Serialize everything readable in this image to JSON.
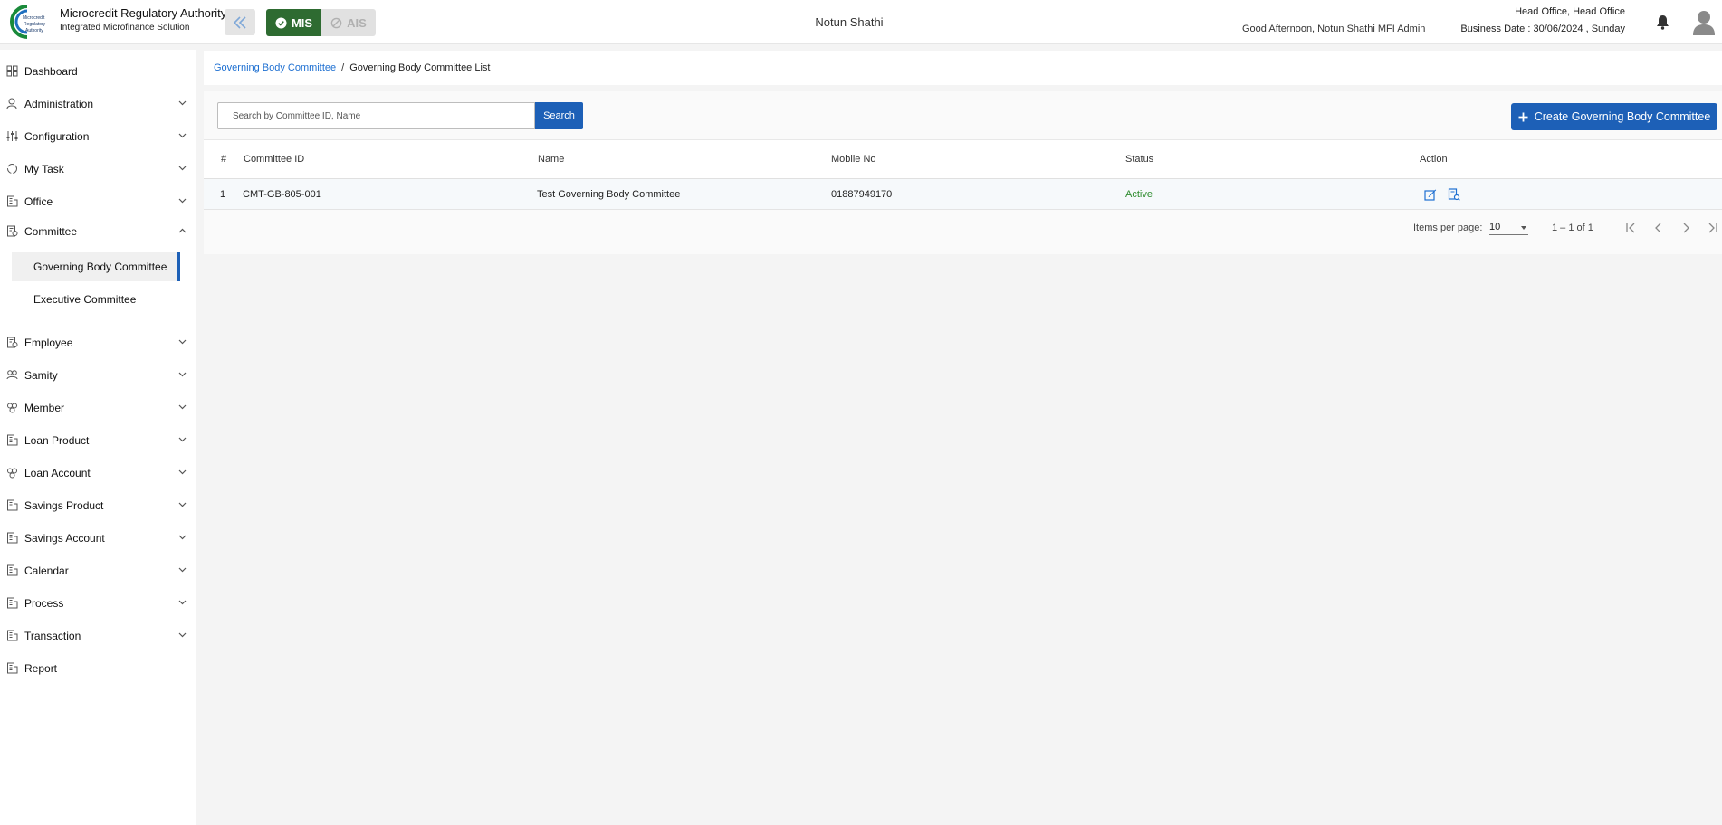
{
  "header": {
    "brand_title": "Microcredit Regulatory Authority",
    "brand_subtitle": "Integrated Microfinance Solution",
    "logo_text": [
      "Microcredit",
      "Regulatory",
      "Authority"
    ],
    "mode_mis": "MIS",
    "mode_ais": "AIS",
    "org_name": "Notun Shathi",
    "greeting": "Good Afternoon, Notun Shathi MFI Admin",
    "office": "Head Office, Head Office",
    "business_date": "Business Date : 30/06/2024 , Sunday"
  },
  "sidebar": {
    "items": [
      {
        "label": "Dashboard"
      },
      {
        "label": "Administration"
      },
      {
        "label": "Configuration"
      },
      {
        "label": "My Task"
      },
      {
        "label": "Office"
      },
      {
        "label": "Committee"
      },
      {
        "label": "Employee"
      },
      {
        "label": "Samity"
      },
      {
        "label": "Member"
      },
      {
        "label": "Loan Product"
      },
      {
        "label": "Loan Account"
      },
      {
        "label": "Savings Product"
      },
      {
        "label": "Savings Account"
      },
      {
        "label": "Calendar"
      },
      {
        "label": "Process"
      },
      {
        "label": "Transaction"
      },
      {
        "label": "Report"
      }
    ],
    "committee_sub": [
      {
        "label": "Governing Body Committee"
      },
      {
        "label": "Executive Committee"
      }
    ]
  },
  "breadcrumb": {
    "parent": "Governing Body Committee",
    "separator": "/",
    "current": "Governing Body Committee List"
  },
  "search": {
    "placeholder": "Search by Committee ID, Name",
    "button": "Search"
  },
  "create_button": "Create Governing Body Committee",
  "table": {
    "headers": [
      "#",
      "Committee ID",
      "Name",
      "Mobile No",
      "Status",
      "Action"
    ],
    "rows": [
      {
        "index": "1",
        "committee_id": "CMT-GB-805-001",
        "name": "Test Governing Body Committee",
        "mobile": "01887949170",
        "status": "Active"
      }
    ]
  },
  "paginator": {
    "items_per_page_label": "Items per page:",
    "page_size": "10",
    "range": "1 – 1 of 1"
  },
  "colors": {
    "primary": "#1d60b7",
    "mis_green": "#2e6b31",
    "active_status": "#2e8b2e",
    "link": "#1d6fd1"
  }
}
